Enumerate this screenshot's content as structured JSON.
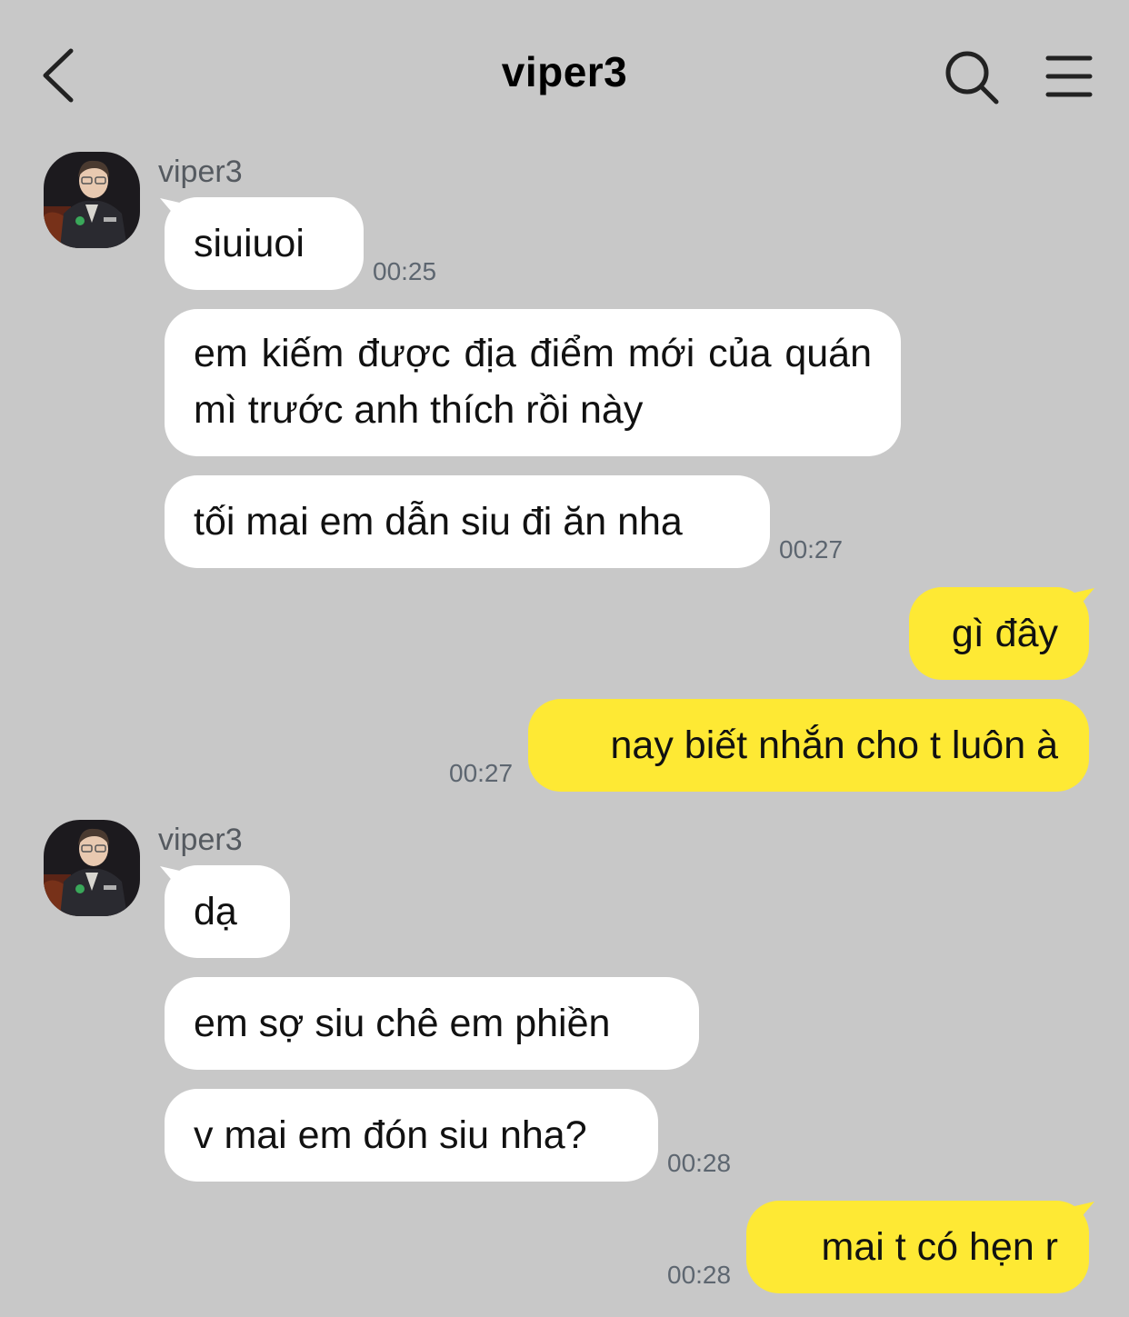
{
  "header": {
    "title": "viper3",
    "back_icon": "chevron-left-icon",
    "search_icon": "search-icon",
    "menu_icon": "hamburger-menu-icon"
  },
  "colors": {
    "background": "#c8c8c8",
    "incoming_bubble": "#ffffff",
    "outgoing_bubble": "#fee934",
    "timestamp": "#5d6670"
  },
  "groups": [
    {
      "sender": "viper3",
      "messages": [
        {
          "text": "siuiuoi",
          "time": "00:25"
        },
        {
          "text": "em kiếm được địa điểm mới của quán mì trước anh thích rồi này"
        },
        {
          "text": "tối mai em dẫn siu đi ăn nha",
          "time": "00:27"
        }
      ]
    },
    {
      "sender": "me",
      "messages": [
        {
          "text": "gì đây"
        },
        {
          "text": "nay biết nhắn cho t luôn à",
          "time": "00:27"
        }
      ]
    },
    {
      "sender": "viper3",
      "messages": [
        {
          "text": "dạ"
        },
        {
          "text": "em sợ siu chê em phiền"
        },
        {
          "text": "v mai em đón siu nha?",
          "time": "00:28"
        }
      ]
    },
    {
      "sender": "me",
      "messages": [
        {
          "text": "mai t có hẹn r",
          "time": "00:28"
        }
      ]
    }
  ]
}
